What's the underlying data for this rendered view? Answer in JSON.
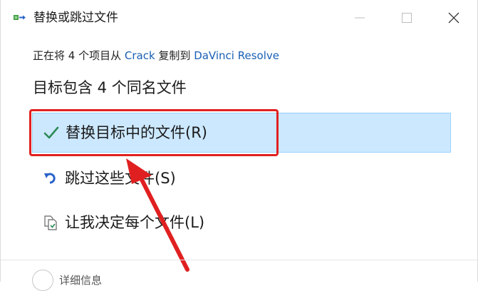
{
  "window": {
    "title": "替换或跳过文件",
    "controls": {
      "minimize": "minimize-icon",
      "maximize": "maximize-icon",
      "close": "close-icon"
    }
  },
  "copy_info": {
    "prefix": "正在将 4 个项目从 ",
    "source": "Crack",
    "middle": " 复制到 ",
    "destination": "DaVinci Resolve"
  },
  "heading": "目标包含 4 个同名文件",
  "options": [
    {
      "label": "替换目标中的文件(R)",
      "icon": "checkmark-icon",
      "selected": true
    },
    {
      "label": "跳过这些文件(S)",
      "icon": "skip-arrow-icon",
      "selected": false
    },
    {
      "label": "让我决定每个文件(L)",
      "icon": "compare-files-icon",
      "selected": false
    }
  ],
  "footer": {
    "details_label": "详细信息"
  },
  "colors": {
    "selected_bg": "#cce8ff",
    "selected_border": "#99d1ff",
    "link": "#1a5fb4",
    "check": "#2e8b57",
    "annotation": "#e02020"
  }
}
